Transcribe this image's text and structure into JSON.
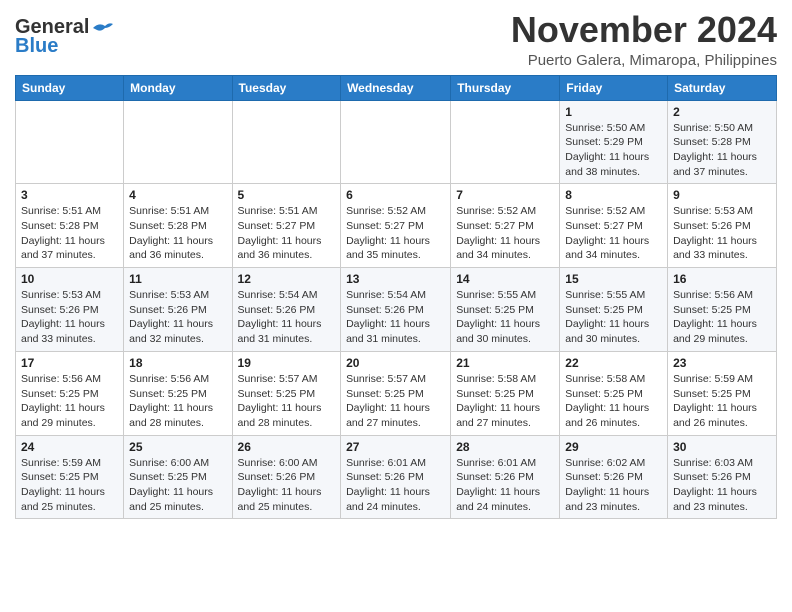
{
  "header": {
    "logo_general": "General",
    "logo_blue": "Blue",
    "month_title": "November 2024",
    "location": "Puerto Galera, Mimaropa, Philippines"
  },
  "days_of_week": [
    "Sunday",
    "Monday",
    "Tuesday",
    "Wednesday",
    "Thursday",
    "Friday",
    "Saturday"
  ],
  "weeks": [
    [
      {
        "day": "",
        "info": ""
      },
      {
        "day": "",
        "info": ""
      },
      {
        "day": "",
        "info": ""
      },
      {
        "day": "",
        "info": ""
      },
      {
        "day": "",
        "info": ""
      },
      {
        "day": "1",
        "info": "Sunrise: 5:50 AM\nSunset: 5:29 PM\nDaylight: 11 hours and 38 minutes."
      },
      {
        "day": "2",
        "info": "Sunrise: 5:50 AM\nSunset: 5:28 PM\nDaylight: 11 hours and 37 minutes."
      }
    ],
    [
      {
        "day": "3",
        "info": "Sunrise: 5:51 AM\nSunset: 5:28 PM\nDaylight: 11 hours and 37 minutes."
      },
      {
        "day": "4",
        "info": "Sunrise: 5:51 AM\nSunset: 5:28 PM\nDaylight: 11 hours and 36 minutes."
      },
      {
        "day": "5",
        "info": "Sunrise: 5:51 AM\nSunset: 5:27 PM\nDaylight: 11 hours and 36 minutes."
      },
      {
        "day": "6",
        "info": "Sunrise: 5:52 AM\nSunset: 5:27 PM\nDaylight: 11 hours and 35 minutes."
      },
      {
        "day": "7",
        "info": "Sunrise: 5:52 AM\nSunset: 5:27 PM\nDaylight: 11 hours and 34 minutes."
      },
      {
        "day": "8",
        "info": "Sunrise: 5:52 AM\nSunset: 5:27 PM\nDaylight: 11 hours and 34 minutes."
      },
      {
        "day": "9",
        "info": "Sunrise: 5:53 AM\nSunset: 5:26 PM\nDaylight: 11 hours and 33 minutes."
      }
    ],
    [
      {
        "day": "10",
        "info": "Sunrise: 5:53 AM\nSunset: 5:26 PM\nDaylight: 11 hours and 33 minutes."
      },
      {
        "day": "11",
        "info": "Sunrise: 5:53 AM\nSunset: 5:26 PM\nDaylight: 11 hours and 32 minutes."
      },
      {
        "day": "12",
        "info": "Sunrise: 5:54 AM\nSunset: 5:26 PM\nDaylight: 11 hours and 31 minutes."
      },
      {
        "day": "13",
        "info": "Sunrise: 5:54 AM\nSunset: 5:26 PM\nDaylight: 11 hours and 31 minutes."
      },
      {
        "day": "14",
        "info": "Sunrise: 5:55 AM\nSunset: 5:25 PM\nDaylight: 11 hours and 30 minutes."
      },
      {
        "day": "15",
        "info": "Sunrise: 5:55 AM\nSunset: 5:25 PM\nDaylight: 11 hours and 30 minutes."
      },
      {
        "day": "16",
        "info": "Sunrise: 5:56 AM\nSunset: 5:25 PM\nDaylight: 11 hours and 29 minutes."
      }
    ],
    [
      {
        "day": "17",
        "info": "Sunrise: 5:56 AM\nSunset: 5:25 PM\nDaylight: 11 hours and 29 minutes."
      },
      {
        "day": "18",
        "info": "Sunrise: 5:56 AM\nSunset: 5:25 PM\nDaylight: 11 hours and 28 minutes."
      },
      {
        "day": "19",
        "info": "Sunrise: 5:57 AM\nSunset: 5:25 PM\nDaylight: 11 hours and 28 minutes."
      },
      {
        "day": "20",
        "info": "Sunrise: 5:57 AM\nSunset: 5:25 PM\nDaylight: 11 hours and 27 minutes."
      },
      {
        "day": "21",
        "info": "Sunrise: 5:58 AM\nSunset: 5:25 PM\nDaylight: 11 hours and 27 minutes."
      },
      {
        "day": "22",
        "info": "Sunrise: 5:58 AM\nSunset: 5:25 PM\nDaylight: 11 hours and 26 minutes."
      },
      {
        "day": "23",
        "info": "Sunrise: 5:59 AM\nSunset: 5:25 PM\nDaylight: 11 hours and 26 minutes."
      }
    ],
    [
      {
        "day": "24",
        "info": "Sunrise: 5:59 AM\nSunset: 5:25 PM\nDaylight: 11 hours and 25 minutes."
      },
      {
        "day": "25",
        "info": "Sunrise: 6:00 AM\nSunset: 5:25 PM\nDaylight: 11 hours and 25 minutes."
      },
      {
        "day": "26",
        "info": "Sunrise: 6:00 AM\nSunset: 5:26 PM\nDaylight: 11 hours and 25 minutes."
      },
      {
        "day": "27",
        "info": "Sunrise: 6:01 AM\nSunset: 5:26 PM\nDaylight: 11 hours and 24 minutes."
      },
      {
        "day": "28",
        "info": "Sunrise: 6:01 AM\nSunset: 5:26 PM\nDaylight: 11 hours and 24 minutes."
      },
      {
        "day": "29",
        "info": "Sunrise: 6:02 AM\nSunset: 5:26 PM\nDaylight: 11 hours and 23 minutes."
      },
      {
        "day": "30",
        "info": "Sunrise: 6:03 AM\nSunset: 5:26 PM\nDaylight: 11 hours and 23 minutes."
      }
    ]
  ]
}
